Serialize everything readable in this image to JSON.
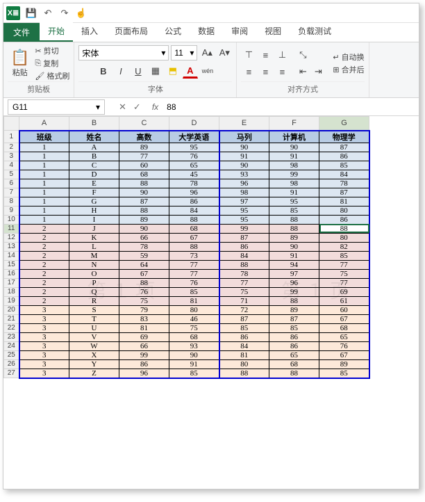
{
  "qat": {
    "save": "💾",
    "undo": "↶",
    "redo": "↷",
    "touch": "☝"
  },
  "tabs": {
    "file": "文件",
    "items": [
      "开始",
      "插入",
      "页面布局",
      "公式",
      "数据",
      "审阅",
      "视图",
      "负载测试"
    ],
    "active": 0
  },
  "ribbon": {
    "clipboard": {
      "paste": "粘贴",
      "cut": "剪切",
      "copy": "复制",
      "format": "格式刷",
      "label": "剪贴板"
    },
    "font": {
      "name": "宋体",
      "size": "11",
      "grow": "A▴",
      "shrink": "A▾",
      "bold": "B",
      "italic": "I",
      "underline": "U",
      "border": "▦",
      "fill": "⬒",
      "color": "A",
      "pinyin": "wén",
      "label": "字体"
    },
    "align": {
      "wrap": "自动换",
      "merge": "合并后",
      "label": "对齐方式"
    }
  },
  "namebar": {
    "cell": "G11",
    "cancel": "✕",
    "ok": "✓",
    "fx": "fx",
    "formula": "88"
  },
  "columns": [
    "A",
    "B",
    "C",
    "D",
    "E",
    "F",
    "G"
  ],
  "headers": [
    "班级",
    "姓名",
    "高数",
    "大学英语",
    "马列",
    "计算机",
    "物理学"
  ],
  "watermarks": [
    "第 １ 项",
    "第 １ 页"
  ],
  "rows": [
    {
      "cls": "c1",
      "r": [
        "1",
        "A",
        "89",
        "95",
        "90",
        "90",
        "87"
      ]
    },
    {
      "cls": "c1",
      "r": [
        "1",
        "B",
        "77",
        "76",
        "91",
        "91",
        "86"
      ]
    },
    {
      "cls": "c1",
      "r": [
        "1",
        "C",
        "60",
        "65",
        "90",
        "98",
        "85"
      ]
    },
    {
      "cls": "c1",
      "r": [
        "1",
        "D",
        "68",
        "45",
        "93",
        "99",
        "84"
      ]
    },
    {
      "cls": "c1",
      "r": [
        "1",
        "E",
        "88",
        "78",
        "96",
        "98",
        "78"
      ]
    },
    {
      "cls": "c1",
      "r": [
        "1",
        "F",
        "90",
        "96",
        "98",
        "91",
        "87"
      ]
    },
    {
      "cls": "c1",
      "r": [
        "1",
        "G",
        "87",
        "86",
        "97",
        "95",
        "81"
      ]
    },
    {
      "cls": "c1",
      "r": [
        "1",
        "H",
        "88",
        "84",
        "95",
        "85",
        "80"
      ]
    },
    {
      "cls": "c1",
      "r": [
        "1",
        "I",
        "89",
        "88",
        "95",
        "88",
        "86"
      ]
    },
    {
      "cls": "c2",
      "r": [
        "2",
        "J",
        "90",
        "68",
        "99",
        "88",
        "88"
      ]
    },
    {
      "cls": "c2",
      "r": [
        "2",
        "K",
        "66",
        "67",
        "87",
        "89",
        "80"
      ]
    },
    {
      "cls": "c2",
      "r": [
        "2",
        "L",
        "78",
        "88",
        "86",
        "90",
        "82"
      ]
    },
    {
      "cls": "c2",
      "r": [
        "2",
        "M",
        "59",
        "73",
        "84",
        "91",
        "85"
      ]
    },
    {
      "cls": "c2",
      "r": [
        "2",
        "N",
        "64",
        "77",
        "88",
        "94",
        "77"
      ]
    },
    {
      "cls": "c2",
      "r": [
        "2",
        "O",
        "67",
        "77",
        "78",
        "97",
        "75"
      ]
    },
    {
      "cls": "c2",
      "r": [
        "2",
        "P",
        "88",
        "76",
        "77",
        "96",
        "77"
      ]
    },
    {
      "cls": "c2",
      "r": [
        "2",
        "Q",
        "76",
        "85",
        "75",
        "99",
        "69"
      ]
    },
    {
      "cls": "c2",
      "r": [
        "2",
        "R",
        "75",
        "81",
        "71",
        "88",
        "61"
      ]
    },
    {
      "cls": "c3",
      "r": [
        "3",
        "S",
        "79",
        "80",
        "72",
        "89",
        "60"
      ]
    },
    {
      "cls": "c3",
      "r": [
        "3",
        "T",
        "83",
        "46",
        "87",
        "87",
        "67"
      ]
    },
    {
      "cls": "c3",
      "r": [
        "3",
        "U",
        "81",
        "75",
        "85",
        "85",
        "68"
      ]
    },
    {
      "cls": "c3",
      "r": [
        "3",
        "V",
        "69",
        "68",
        "86",
        "86",
        "65"
      ]
    },
    {
      "cls": "c3",
      "r": [
        "3",
        "W",
        "66",
        "93",
        "84",
        "86",
        "76"
      ]
    },
    {
      "cls": "c3",
      "r": [
        "3",
        "X",
        "99",
        "90",
        "81",
        "65",
        "67"
      ]
    },
    {
      "cls": "c3",
      "r": [
        "3",
        "Y",
        "86",
        "91",
        "80",
        "68",
        "89"
      ]
    },
    {
      "cls": "c3",
      "r": [
        "3",
        "Z",
        "96",
        "85",
        "88",
        "88",
        "85"
      ]
    }
  ],
  "active": {
    "row": 9,
    "col": 6
  }
}
